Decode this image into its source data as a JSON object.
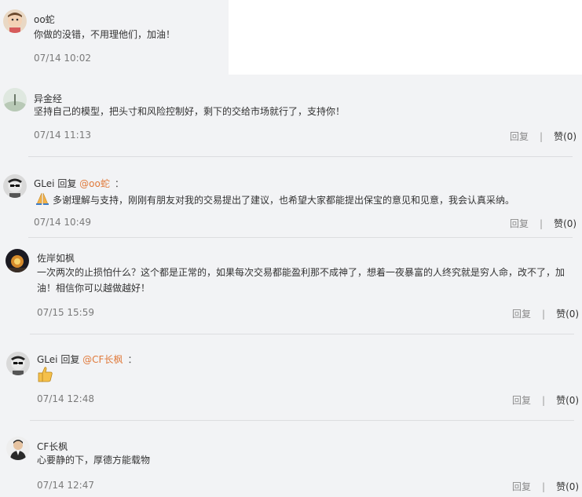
{
  "comments": [
    {
      "author": "oo蛇",
      "text": "你做的没错，不用理他们，加油！",
      "time": "07/14 10:02"
    },
    {
      "author": "异金经",
      "text": "坚持自己的模型，把头寸和风险控制好，剩下的交给市场就行了，支持你！",
      "time": "07/14 11:13",
      "reply_label": "回复",
      "separator": "|",
      "like_label": "赞(0)"
    },
    {
      "author": "GLei",
      "reply_word": "回复",
      "mention": "@oo蛇",
      "colon": "：",
      "emoji_icon": "praying-hands-emoji",
      "text": "多谢理解与支持，刚刚有朋友对我的交易提出了建议，也希望大家都能提出保宝的意见和见意，我会认真采纳。",
      "time": "07/14 10:49",
      "reply_label": "回复",
      "separator": "|",
      "like_label": "赞(0)"
    },
    {
      "author": "佐岸如枫",
      "text_line1": "一次两次的止损怕什么？这个都是正常的，如果每次交易都能盈利那不成神了，想着一夜暴富的人终究就是穷人命，改不了，加",
      "text_line2": "油！相信你可以越做越好！",
      "time": "07/15 15:59",
      "reply_label": "回复",
      "separator": "|",
      "like_label": "赞(0)"
    },
    {
      "author": "GLei",
      "reply_word": "回复",
      "mention": "@CF长枫",
      "colon": "：",
      "emoji_icon": "thumbs-up-emoji",
      "time": "07/14 12:48",
      "reply_label": "回复",
      "separator": "|",
      "like_label": "赞(0)"
    },
    {
      "author": "CF长枫",
      "text": "心要静的下，厚德方能载物",
      "time": "07/14 12:47",
      "reply_label": "回复",
      "separator": "|",
      "like_label": "赞(0)"
    }
  ],
  "colors": {
    "card_bg": "#f2f3f5",
    "mention": "#e07a3b",
    "time": "#7a7a7a"
  }
}
